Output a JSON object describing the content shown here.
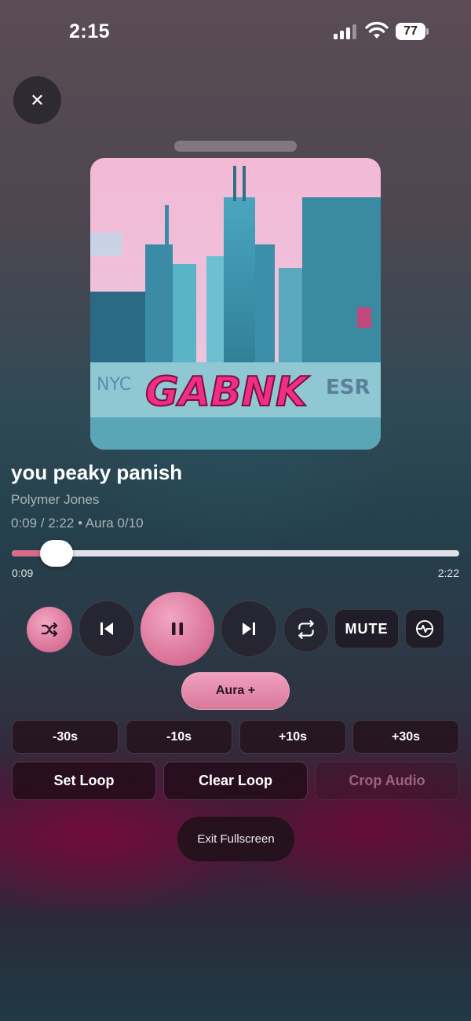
{
  "status_bar": {
    "time": "2:15",
    "battery": "77"
  },
  "icons": {
    "close": "close-icon",
    "shuffle": "shuffle-icon",
    "previous": "skip-previous-icon",
    "pause": "pause-icon",
    "next": "skip-next-icon",
    "repeat": "repeat-icon",
    "visualizer": "visualizer-icon"
  },
  "track": {
    "title": "you peaky panish",
    "artist": "Polymer Jones",
    "meta": "0:09 / 2:22 • Aura 0/10",
    "cover_text": "GABNK"
  },
  "progress": {
    "current": "0:09",
    "total": "2:22",
    "fraction": 0.0985
  },
  "controls": {
    "mute_label": "MUTE",
    "aura_label": "Aura +",
    "seek": [
      "-30s",
      "-10s",
      "+10s",
      "+30s"
    ],
    "set_loop": "Set Loop",
    "clear_loop": "Clear Loop",
    "crop_audio": "Crop Audio",
    "exit_fullscreen": "Exit Fullscreen"
  },
  "colors": {
    "accent_pink": "#d87096",
    "progress_fill": "#d86a8a"
  }
}
